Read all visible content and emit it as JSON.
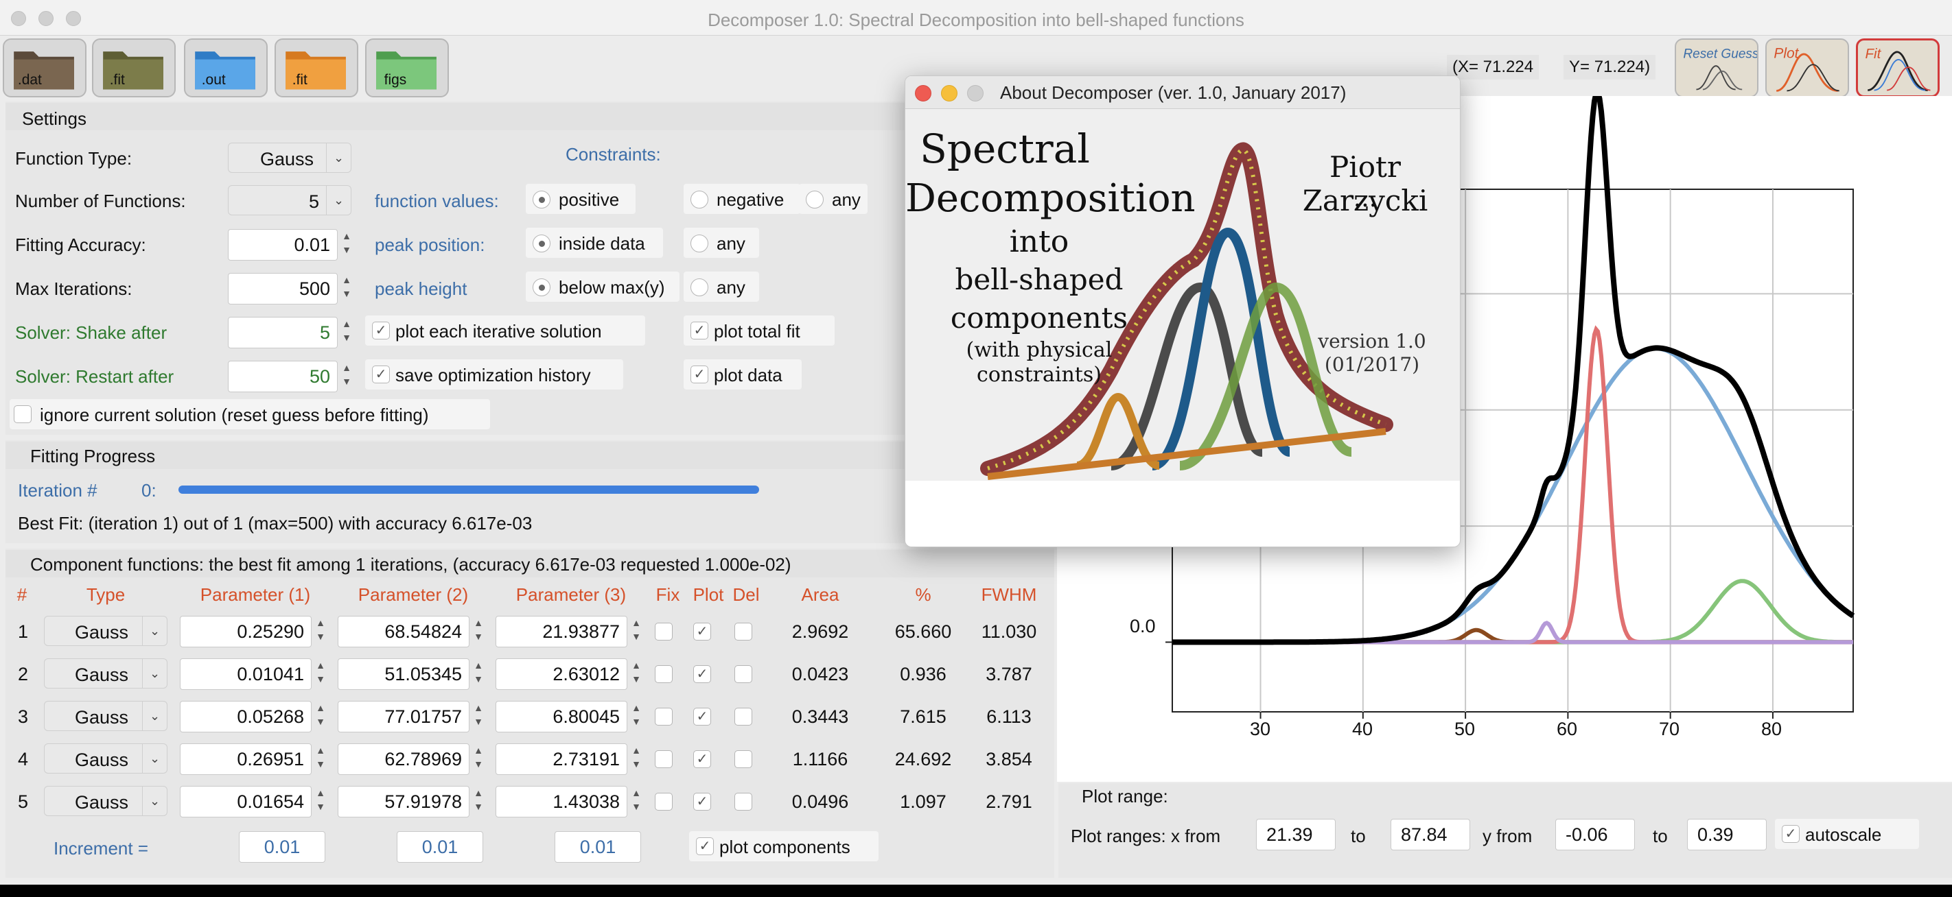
{
  "window": {
    "title": "Decomposer 1.0: Spectral Decomposition into bell-shaped functions"
  },
  "toolbar": {
    "buttons": [
      {
        "label": ".dat",
        "color": "#5b4a3a"
      },
      {
        "label": ".fit",
        "color": "#6a6a3a"
      },
      {
        "label": ".out",
        "color": "#3a8ad6"
      },
      {
        "label": ".fit",
        "color": "#e08a2a"
      },
      {
        "label": "figs",
        "color": "#5fae5f"
      }
    ],
    "coord_x": "(X= 71.224",
    "coord_y": "Y= 71.224)",
    "right_buttons": [
      {
        "label": "Reset Guess"
      },
      {
        "label": "Plot"
      },
      {
        "label": "Fit"
      }
    ]
  },
  "settings": {
    "header": "Settings",
    "function_type_label": "Function Type:",
    "function_type_value": "Gauss",
    "num_functions_label": "Number of Functions:",
    "num_functions_value": "5",
    "accuracy_label": "Fitting Accuracy:",
    "accuracy_value": "0.01",
    "max_iter_label": "Max Iterations:",
    "max_iter_value": "500",
    "shake_label": "Solver: Shake after",
    "shake_value": "5",
    "restart_label": "Solver: Restart after",
    "restart_value": "50",
    "constraints_label": "Constraints:",
    "function_values_label": "function values:",
    "opt_positive": "positive",
    "opt_negative": "negative",
    "opt_any1": "any",
    "peak_position_label": "peak position:",
    "opt_inside_data": "inside data",
    "opt_any2": "any",
    "peak_height_label": "peak height",
    "opt_below_max": "below max(y)",
    "opt_any3": "any",
    "plot_each": "plot each iterative solution",
    "plot_total": "plot total fit",
    "save_history": "save optimization history",
    "plot_data": "plot data",
    "ignore_current": "ignore current solution (reset guess before fitting)"
  },
  "progress": {
    "header": "Fitting Progress",
    "iteration_label": "Iteration #",
    "iteration_value": "0:",
    "fraction": 1.0,
    "best_fit": "Best Fit: (iteration   1) out of   1 (max=500) with accuracy 6.617e-03"
  },
  "components": {
    "header": "Component functions: the best fit among   1 iterations, (accuracy 6.617e-03 requested 1.000e-02)",
    "columns": [
      "#",
      "Type",
      "Parameter (1)",
      "Parameter (2)",
      "Parameter (3)",
      "Fix",
      "Plot",
      "Del",
      "Area",
      "%",
      "FWHM"
    ],
    "rows": [
      {
        "n": "1",
        "type": "Gauss",
        "p1": "0.25290",
        "p2": "68.54824",
        "p3": "21.93877",
        "area": "2.9692",
        "pct": "65.660",
        "fwhm": "11.030"
      },
      {
        "n": "2",
        "type": "Gauss",
        "p1": "0.01041",
        "p2": "51.05345",
        "p3": "2.63012",
        "area": "0.0423",
        "pct": "0.936",
        "fwhm": "3.787"
      },
      {
        "n": "3",
        "type": "Gauss",
        "p1": "0.05268",
        "p2": "77.01757",
        "p3": "6.80045",
        "area": "0.3443",
        "pct": "7.615",
        "fwhm": "6.113"
      },
      {
        "n": "4",
        "type": "Gauss",
        "p1": "0.26951",
        "p2": "62.78969",
        "p3": "2.73191",
        "area": "1.1166",
        "pct": "24.692",
        "fwhm": "3.854"
      },
      {
        "n": "5",
        "type": "Gauss",
        "p1": "0.01654",
        "p2": "57.91978",
        "p3": "1.43038",
        "area": "0.0496",
        "pct": "1.097",
        "fwhm": "2.791"
      }
    ],
    "increment_label": "Increment =",
    "increments": [
      "0.01",
      "0.01",
      "0.01"
    ],
    "plot_components": "plot components"
  },
  "plot": {
    "y_zero_label": "0.0",
    "x_ticks": [
      "30",
      "40",
      "50",
      "60",
      "70",
      "80"
    ],
    "range_header": "Plot range:",
    "range_label": "Plot ranges: x from",
    "x_from": "21.39",
    "to1": "to",
    "x_to": "87.84",
    "y_from_label": "y from",
    "y_from": "-0.06",
    "to2": "to",
    "y_to": "0.39",
    "autoscale": "autoscale"
  },
  "about": {
    "title": "About Decomposer (ver. 1.0, January 2017)",
    "line1": "Spectral",
    "line2": "Decomposition",
    "line3": "into",
    "line4": "bell-shaped",
    "line5": "components",
    "line6": "(with physical",
    "line7": "constraints)",
    "author": "Piotr Zarzycki",
    "dots": "...",
    "version": "version 1.0",
    "date": "(01/2017)"
  }
}
